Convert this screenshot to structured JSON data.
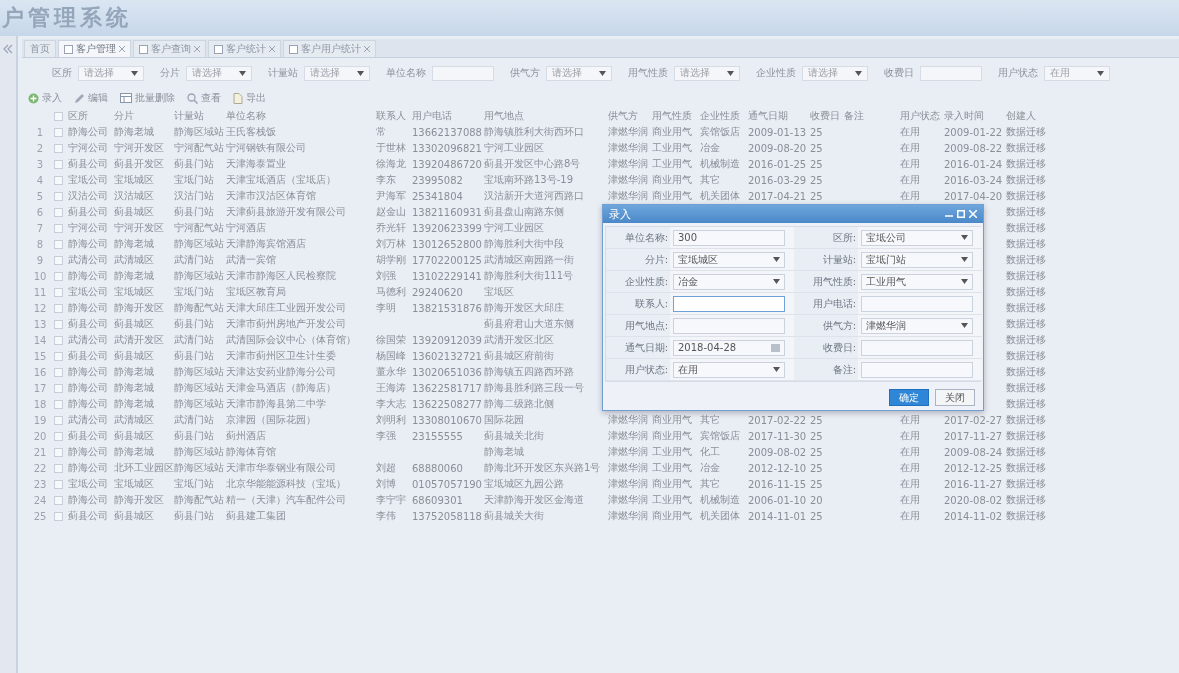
{
  "header": {
    "title": "户管理系统"
  },
  "tabs": [
    {
      "label": "首页",
      "selected": false,
      "closable": false
    },
    {
      "label": "客户管理",
      "selected": true,
      "closable": true
    },
    {
      "label": "客户查询",
      "selected": false,
      "closable": true
    },
    {
      "label": "客户统计",
      "selected": false,
      "closable": true
    },
    {
      "label": "客户用户统计",
      "selected": false,
      "closable": true
    }
  ],
  "filters": [
    {
      "label": "区所",
      "kind": "select",
      "value": "请选择"
    },
    {
      "label": "分片",
      "kind": "select",
      "value": "请选择"
    },
    {
      "label": "计量站",
      "kind": "select",
      "value": "请选择"
    },
    {
      "label": "单位名称",
      "kind": "text"
    },
    {
      "label": "供气方",
      "kind": "select",
      "value": "请选择"
    },
    {
      "label": "用气性质",
      "kind": "select",
      "value": "请选择"
    },
    {
      "label": "企业性质",
      "kind": "select",
      "value": "请选择"
    },
    {
      "label": "收费日",
      "kind": "text"
    },
    {
      "label": "用户状态",
      "kind": "select",
      "value": "在用"
    }
  ],
  "toolbar": [
    {
      "label": "录入",
      "kind": "add"
    },
    {
      "label": "编辑",
      "kind": "edit"
    },
    {
      "label": "批量删除",
      "kind": "delete"
    },
    {
      "label": "查看",
      "kind": "view"
    },
    {
      "label": "导出",
      "kind": "export"
    }
  ],
  "table": {
    "all_checked": false,
    "columns": [
      "区所",
      "分片",
      "计量站",
      "单位名称",
      "联系人",
      "用户电话",
      "用气地点",
      "供气方",
      "用气性质",
      "企业性质",
      "通气日期",
      "收费日",
      "备注",
      "用户状态",
      "录入时间",
      "创建人"
    ],
    "rows": [
      {
        "no": "1",
        "checked": false,
        "cells": [
          "静海公司",
          "静海老城",
          "静海区域站",
          "王氏客栈饭",
          "常",
          "13662137088",
          "静海镇胜利大街西环口",
          "津燃华润",
          "商业用气",
          "宾馆饭店",
          "2009-01-13",
          "25",
          null,
          "在用",
          "2009-01-22",
          "数据迁移"
        ]
      },
      {
        "no": "2",
        "checked": false,
        "cells": [
          "宁河公司",
          "宁河开发区",
          "宁河配气站",
          "宁河钢铁有限公司",
          "于世林",
          "13302096821",
          "宁河工业园区",
          "津燃华润",
          "工业用气",
          "冶金",
          "2009-08-20",
          "25",
          null,
          "在用",
          "2009-08-22",
          "数据迁移"
        ]
      },
      {
        "no": "3",
        "checked": false,
        "cells": [
          "蓟县公司",
          "蓟县开发区",
          "蓟县门站",
          "天津海泰置业",
          "徐海龙",
          "13920486720",
          "蓟县开发区中心路8号",
          "津燃华润",
          "工业用气",
          "机械制造",
          "2016-01-25",
          "25",
          null,
          "在用",
          "2016-01-24",
          "数据迁移"
        ]
      },
      {
        "no": "4",
        "checked": false,
        "cells": [
          "宝坻公司",
          "宝坻城区",
          "宝坻门站",
          "天津宝坻酒店（宝坻店）",
          "李东",
          "23995082",
          "宝坻南环路13号-19",
          "津燃华润",
          "商业用气",
          "其它",
          "2016-03-29",
          "25",
          null,
          "在用",
          "2016-03-24",
          "数据迁移"
        ]
      },
      {
        "no": "5",
        "checked": false,
        "cells": [
          "汉沽公司",
          "汉沽城区",
          "汉沽门站",
          "天津市汉沽区体育馆",
          "尹海军",
          "25341804",
          "汉沽新开大道河西路口",
          "津燃华润",
          "商业用气",
          "机关团体",
          "2017-04-21",
          "25",
          null,
          "在用",
          "2017-04-20",
          "数据迁移"
        ]
      },
      {
        "no": "6",
        "checked": false,
        "cells": [
          "蓟县公司",
          "蓟县城区",
          "蓟县门站",
          "天津蓟县旅游开发有限公司",
          "赵金山",
          "13821160931",
          "蓟县盘山南路东侧",
          null,
          null,
          null,
          null,
          null,
          null,
          null,
          null,
          "数据迁移"
        ]
      },
      {
        "no": "7",
        "checked": false,
        "cells": [
          "宁河公司",
          "宁河开发区",
          "宁河配气站",
          "宁河酒店",
          "乔光轩",
          "13920623399",
          "宁河工业园区",
          null,
          null,
          null,
          null,
          null,
          null,
          null,
          null,
          "数据迁移"
        ]
      },
      {
        "no": "8",
        "checked": false,
        "cells": [
          "静海公司",
          "静海老城",
          "静海区域站",
          "天津静海宾馆酒店",
          "刘万林",
          "13012652800",
          "静海胜利大街中段",
          null,
          null,
          null,
          null,
          null,
          null,
          null,
          null,
          "数据迁移"
        ]
      },
      {
        "no": "9",
        "checked": false,
        "cells": [
          "武清公司",
          "武清城区",
          "武清门站",
          "武清一宾馆",
          "胡学刚",
          "17702200125",
          "武清城区南园路一街",
          null,
          null,
          null,
          null,
          null,
          null,
          null,
          null,
          "数据迁移"
        ]
      },
      {
        "no": "10",
        "checked": false,
        "cells": [
          "静海公司",
          "静海老城",
          "静海区域站",
          "天津市静海区人民检察院",
          "刘强",
          "13102229141",
          "静海胜利大街111号",
          null,
          null,
          null,
          null,
          null,
          null,
          null,
          null,
          "数据迁移"
        ]
      },
      {
        "no": "11",
        "checked": false,
        "cells": [
          "宝坻公司",
          "宝坻城区",
          "宝坻门站",
          "宝坻区教育局",
          "马德利",
          "29240620",
          "宝坻区",
          null,
          null,
          null,
          null,
          null,
          null,
          null,
          null,
          "数据迁移"
        ]
      },
      {
        "no": "12",
        "checked": false,
        "cells": [
          "静海公司",
          "静海开发区",
          "静海配气站",
          "天津大邱庄工业园开发公司",
          "李明",
          "13821531876",
          "静海开发区大邱庄",
          null,
          null,
          null,
          null,
          null,
          null,
          null,
          null,
          "数据迁移"
        ]
      },
      {
        "no": "13",
        "checked": false,
        "cells": [
          "蓟县公司",
          "蓟县城区",
          "蓟县门站",
          "天津市蓟州房地产开发公司",
          null,
          null,
          "蓟县府君山大道东侧",
          null,
          null,
          null,
          null,
          null,
          null,
          null,
          null,
          "数据迁移"
        ]
      },
      {
        "no": "14",
        "checked": false,
        "cells": [
          "武清公司",
          "武清开发区",
          "武清门站",
          "武清国际会议中心（体育馆）",
          "徐国荣",
          "13920912039",
          "武清开发区北区",
          null,
          null,
          null,
          null,
          null,
          null,
          null,
          null,
          "数据迁移"
        ]
      },
      {
        "no": "15",
        "checked": false,
        "cells": [
          "蓟县公司",
          "蓟县城区",
          "蓟县门站",
          "天津市蓟州区卫生计生委",
          "杨国峰",
          "13602132721",
          "蓟县城区府前街",
          null,
          null,
          null,
          null,
          null,
          null,
          null,
          null,
          "数据迁移"
        ]
      },
      {
        "no": "16",
        "checked": false,
        "cells": [
          "静海公司",
          "静海老城",
          "静海区域站",
          "天津达安药业静海分公司",
          "董永华",
          "13020651036",
          "静海镇五四路西环路",
          null,
          null,
          null,
          null,
          null,
          null,
          null,
          null,
          "数据迁移"
        ]
      },
      {
        "no": "17",
        "checked": false,
        "cells": [
          "静海公司",
          "静海老城",
          "静海区域站",
          "天津金马酒店（静海店）",
          "王海涛",
          "13622581717",
          "静海县胜利路三段一号",
          null,
          null,
          null,
          null,
          null,
          null,
          null,
          null,
          "数据迁移"
        ]
      },
      {
        "no": "18",
        "checked": false,
        "cells": [
          "静海公司",
          "静海老城",
          "静海区域站",
          "天津市静海县第二中学",
          "李大志",
          "13622508277",
          "静海二级路北侧",
          null,
          null,
          null,
          null,
          null,
          null,
          null,
          null,
          "数据迁移"
        ]
      },
      {
        "no": "19",
        "checked": false,
        "cells": [
          "武清公司",
          "武清城区",
          "武清门站",
          "京津园（国际花园）",
          "刘明利",
          "13308010670",
          "国际花园",
          "津燃华润",
          "商业用气",
          "其它",
          "2017-02-22",
          "25",
          null,
          "在用",
          "2017-02-27",
          "数据迁移"
        ]
      },
      {
        "no": "20",
        "checked": false,
        "cells": [
          "蓟县公司",
          "蓟县城区",
          "蓟县门站",
          "蓟州酒店",
          "李强",
          "23155555",
          "蓟县城关北街",
          "津燃华润",
          "商业用气",
          "宾馆饭店",
          "2017-11-30",
          "25",
          null,
          "在用",
          "2017-11-27",
          "数据迁移"
        ]
      },
      {
        "no": "21",
        "checked": false,
        "cells": [
          "静海公司",
          "静海老城",
          "静海区域站",
          "静海体育馆",
          null,
          null,
          "静海老城",
          "津燃华润",
          "工业用气",
          "化工",
          "2009-08-02",
          "25",
          null,
          "在用",
          "2009-08-24",
          "数据迁移"
        ]
      },
      {
        "no": "22",
        "checked": false,
        "cells": [
          "静海公司",
          "北环工业园区",
          "静海区域站",
          "天津市华泰钢业有限公司",
          "刘超",
          "68880060",
          "静海北环开发区东兴路1号",
          "津燃华润",
          "工业用气",
          "冶金",
          "2012-12-10",
          "25",
          null,
          "在用",
          "2012-12-25",
          "数据迁移"
        ]
      },
      {
        "no": "23",
        "checked": false,
        "cells": [
          "宝坻公司",
          "宝坻城区",
          "宝坻门站",
          "北京华能能源科技（宝坻）",
          "刘博",
          "01057057190",
          "宝坻城区九园公路",
          "津燃华润",
          "商业用气",
          "其它",
          "2016-11-15",
          "25",
          null,
          "在用",
          "2016-11-27",
          "数据迁移"
        ]
      },
      {
        "no": "24",
        "checked": false,
        "cells": [
          "静海公司",
          "静海开发区",
          "静海配气站",
          "精一（天津）汽车配件公司",
          "李宁宇",
          "68609301",
          "天津静海开发区金海道",
          "津燃华润",
          "工业用气",
          "机械制造",
          "2006-01-10",
          "20",
          null,
          "在用",
          "2020-08-02",
          "数据迁移"
        ]
      },
      {
        "no": "25",
        "checked": false,
        "cells": [
          "蓟县公司",
          "蓟县城区",
          "蓟县门站",
          "蓟县建工集团",
          "李伟",
          "13752058118",
          "蓟县城关大街",
          "津燃华润",
          "商业用气",
          "机关团体",
          "2014-11-01",
          "25",
          null,
          "在用",
          "2014-11-02",
          "数据迁移"
        ]
      }
    ]
  },
  "dialog": {
    "title": "录入",
    "fields": [
      {
        "label": "单位名称:",
        "kind": "text",
        "value": "300",
        "focused": false
      },
      {
        "label": "区所:",
        "kind": "select",
        "value": "宝坻公司",
        "focused": false
      },
      {
        "label": "分片:",
        "kind": "select",
        "value": "宝坻城区",
        "focused": false
      },
      {
        "label": "计量站:",
        "kind": "select",
        "value": "宝坻门站",
        "focused": false
      },
      {
        "label": "企业性质:",
        "kind": "select",
        "value": "冶金",
        "focused": false
      },
      {
        "label": "用气性质:",
        "kind": "select",
        "value": "工业用气",
        "focused": false
      },
      {
        "label": "联系人:",
        "kind": "text",
        "focused": true
      },
      {
        "label": "用户电话:",
        "kind": "text",
        "focused": false
      },
      {
        "label": "用气地点:",
        "kind": "text",
        "focused": false
      },
      {
        "label": "供气方:",
        "kind": "select",
        "value": "津燃华润",
        "focused": false
      },
      {
        "label": "通气日期:",
        "kind": "date",
        "value": "2018-04-28",
        "focused": false
      },
      {
        "label": "收费日:",
        "kind": "text",
        "focused": false
      },
      {
        "label": "用户状态:",
        "kind": "select",
        "value": "在用",
        "focused": false
      },
      {
        "label": "备注:",
        "kind": "text",
        "focused": false
      }
    ],
    "buttons": [
      {
        "label": "确定",
        "kind": "primary"
      },
      {
        "label": "关闭",
        "kind": "secondary"
      }
    ]
  }
}
